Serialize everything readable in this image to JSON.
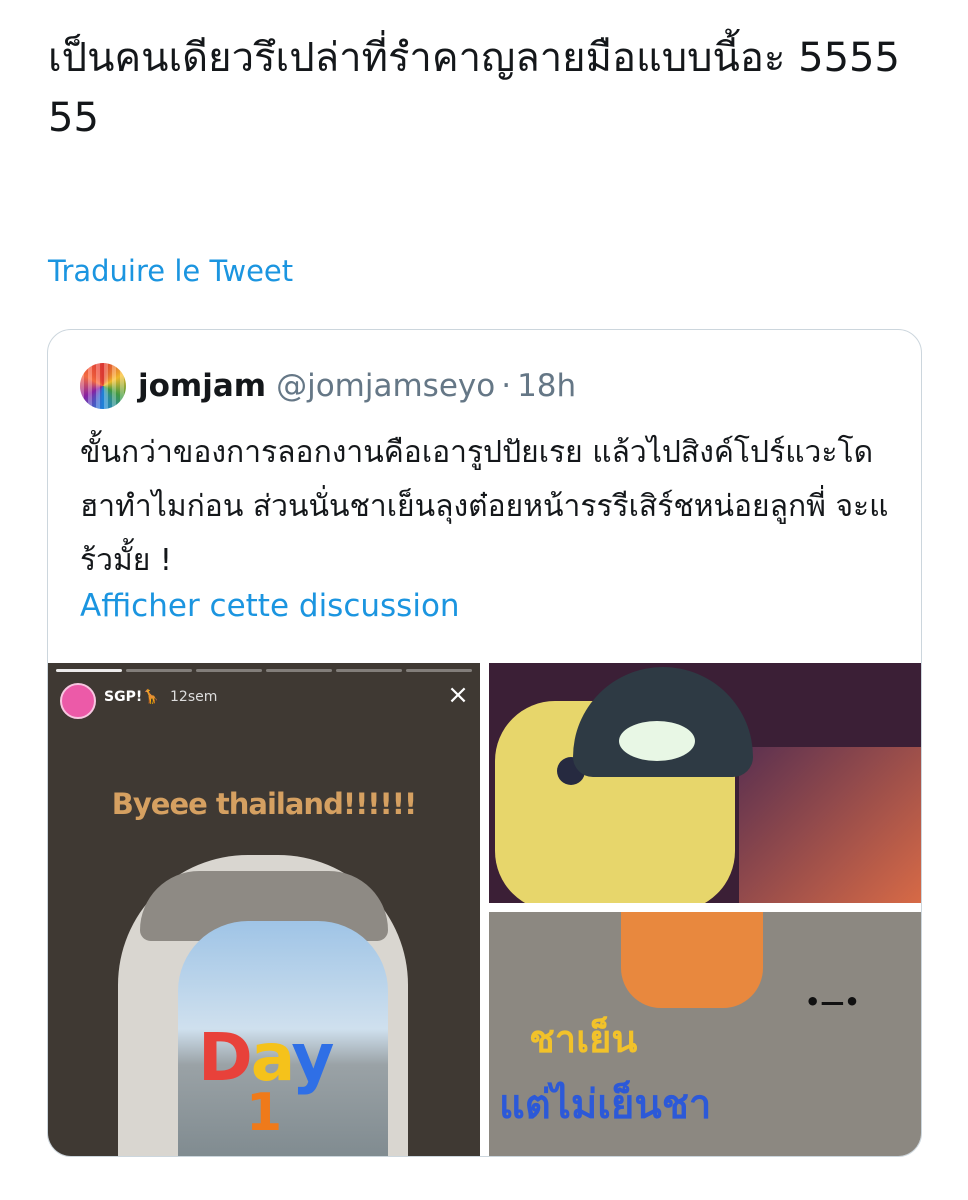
{
  "tweet": {
    "text": "เป็นคนเดียวรึเปล่าที่รำคาญลายมือแบบนี้อะ 555555",
    "translate_label": "Traduire le Tweet"
  },
  "quoted": {
    "display_name": "jomjam",
    "handle": "@jomjamseyo",
    "separator": "·",
    "time": "18h",
    "text": "ขั้นกว่าของการลอกงานคือเอารูปปัยเรย แล้วไปสิงค์โปร์แวะโดฮาทำไมก่อน ส่วนนั่นชาเย็นลุงต๋อยหน้ารรรีเสิร์ชหน่อยลูกพี่ จะแร้วมั้ย !",
    "show_thread_label": "Afficher cette discussion"
  },
  "media": {
    "story": {
      "username": "SGP!🦒",
      "time": "12sem",
      "close_glyph": "×",
      "caption": "Byeee thailand!!!!!!",
      "day_letters": [
        "D",
        "a",
        "y"
      ],
      "day_number": "1"
    },
    "drink": {
      "face": "•—•",
      "handwriting_line1": "ชาเย็น",
      "handwriting_line2": "แต่ไม่เย็นชา"
    }
  },
  "colors": {
    "link": "#1b95e0",
    "text": "#14171a",
    "secondary": "#657786",
    "border": "#ccd6dd"
  }
}
